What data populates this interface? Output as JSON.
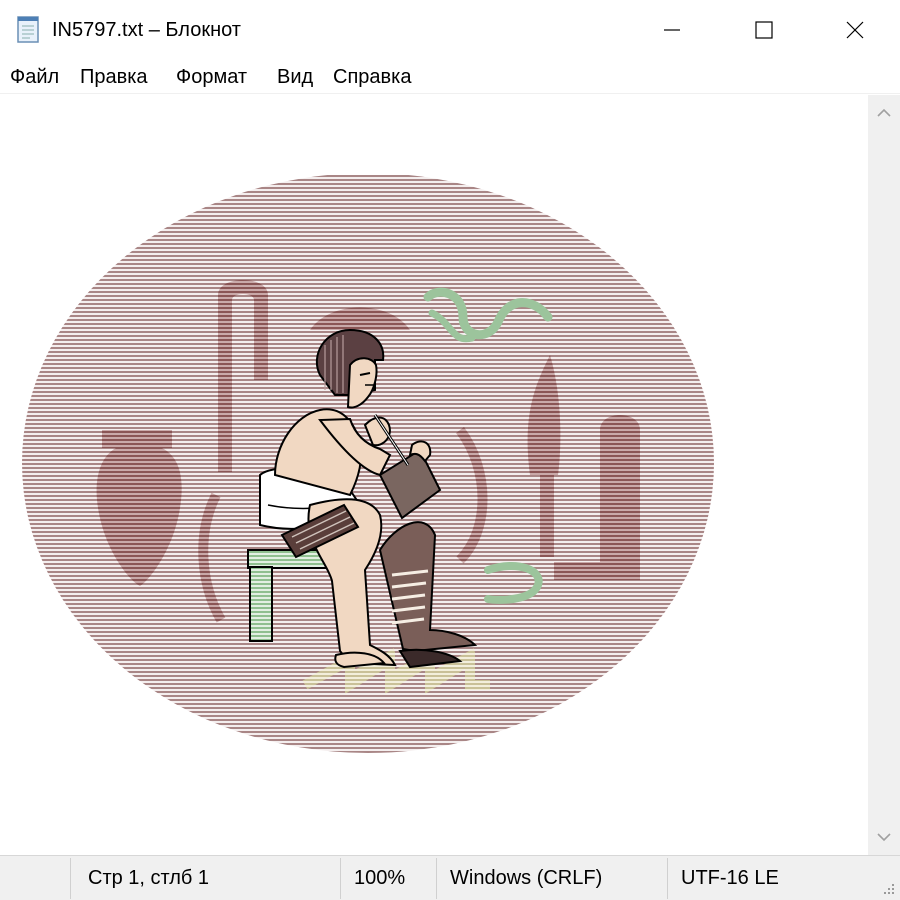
{
  "window": {
    "title": "IN5797.txt – Блокнот",
    "app_icon": "notepad-icon",
    "controls": {
      "minimize_icon": "minimize-icon",
      "maximize_icon": "maximize-icon",
      "close_icon": "close-icon"
    }
  },
  "menu": {
    "items": [
      {
        "label": "Файл"
      },
      {
        "label": "Правка"
      },
      {
        "label": "Формат"
      },
      {
        "label": "Вид"
      },
      {
        "label": "Справка"
      }
    ]
  },
  "editor": {
    "content_description_icon": "egyptian-scribe-artwork"
  },
  "scrollbar": {
    "up_icon": "chevron-up-icon",
    "down_icon": "chevron-down-icon"
  },
  "status": {
    "position": "Стр 1, стлб 1",
    "zoom": "100%",
    "line_endings": "Windows (CRLF)",
    "encoding": "UTF-16 LE"
  },
  "colors": {
    "oval": "#a98686",
    "hieroglyph": "#8f5c5c",
    "snake": "#9cc49c",
    "stool": "#8fbf8f",
    "skin": "#f1d8c2"
  }
}
